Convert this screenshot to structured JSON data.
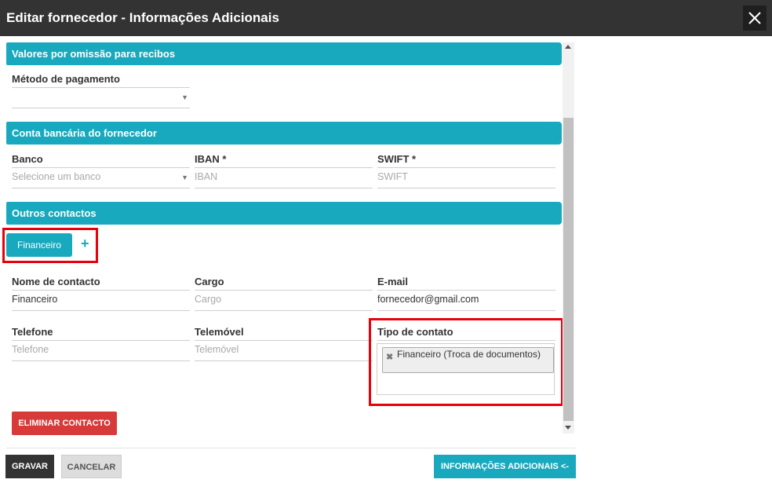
{
  "dialog": {
    "title": "Editar fornecedor - Informações Adicionais"
  },
  "receipt_defaults": {
    "header": "Valores por omissão para recibos",
    "payment_method": {
      "label": "Método de pagamento",
      "value": ""
    }
  },
  "bank_account": {
    "header": "Conta bancária do fornecedor",
    "bank": {
      "label": "Banco",
      "placeholder": "Selecione um banco"
    },
    "iban": {
      "label": "IBAN *",
      "placeholder": "IBAN"
    },
    "swift": {
      "label": "SWIFT *",
      "placeholder": "SWIFT"
    }
  },
  "other_contacts": {
    "header": "Outros contactos",
    "active_tab": "Financeiro",
    "add_symbol": "+",
    "contact_name": {
      "label": "Nome de contacto",
      "value": "Financeiro"
    },
    "role": {
      "label": "Cargo",
      "placeholder": "Cargo"
    },
    "email": {
      "label": "E-mail",
      "value": "fornecedor@gmail.com"
    },
    "phone": {
      "label": "Telefone",
      "placeholder": "Telefone"
    },
    "mobile": {
      "label": "Telemóvel",
      "placeholder": "Telemóvel"
    },
    "contact_type": {
      "label": "Tipo de contato",
      "tags": [
        "Financeiro (Troca de documentos)"
      ]
    },
    "delete_label": "ELIMINAR CONTACTO"
  },
  "footer": {
    "save_label": "GRAVAR",
    "cancel_label": "CANCELAR",
    "info_label": "INFORMAÇÕES ADICIONAIS <-"
  },
  "colors": {
    "accent": "#18a9be",
    "danger": "#d83a3a",
    "titlebar": "#333333",
    "highlight": "#e8000d"
  },
  "icons": {
    "close": "close-icon",
    "add": "plus-icon",
    "remove_tag": "remove-tag-icon",
    "dropdown": "chevron-down-icon"
  }
}
